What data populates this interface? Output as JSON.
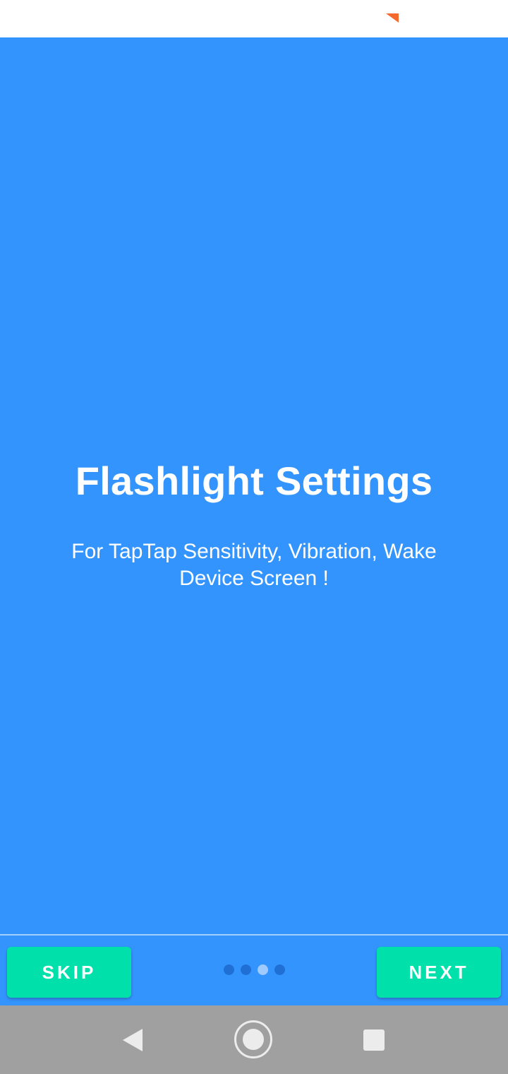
{
  "status_bar": {
    "notification_icon": "notification-corner-icon",
    "notification_color": "#f46a2d"
  },
  "slide": {
    "title": "Flashlight Settings",
    "description": "For TapTap Sensitivity, Vibration, Wake Device Screen !",
    "background_color": "#3494fe"
  },
  "footer": {
    "skip_label": "SKIP",
    "next_label": "NEXT",
    "button_color": "#00e0ab",
    "page_count": 4,
    "current_page": 3
  },
  "navigation_bar": {
    "back_icon": "back-triangle-icon",
    "home_icon": "home-circle-icon",
    "recent_icon": "recent-apps-square-icon"
  }
}
